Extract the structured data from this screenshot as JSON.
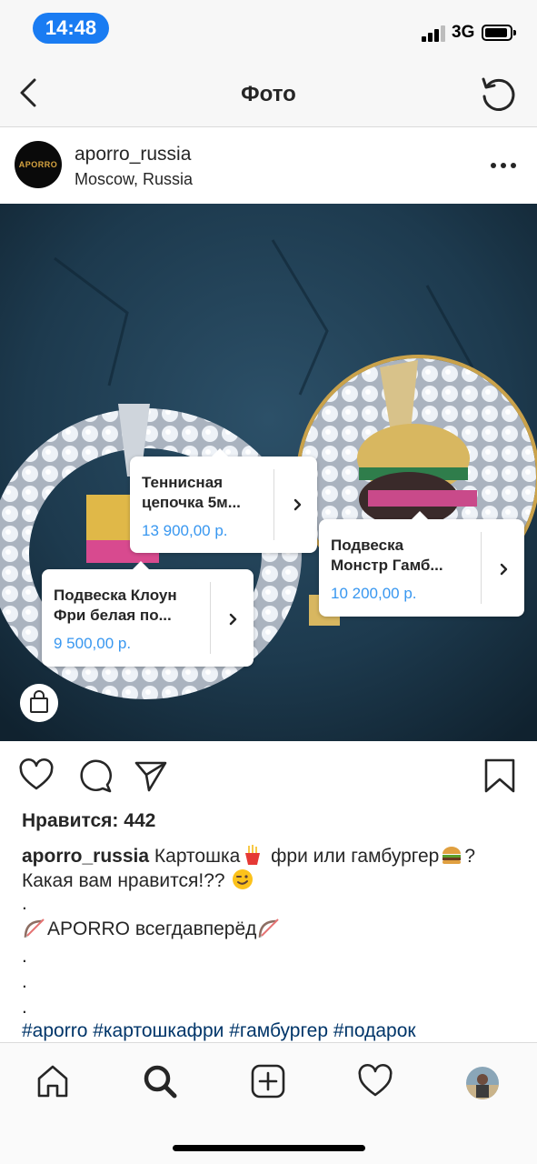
{
  "status_bar": {
    "time": "14:48",
    "network": "3G"
  },
  "nav": {
    "title": "Фото",
    "back_icon": "chevron-left-icon",
    "refresh_icon": "refresh-icon"
  },
  "post": {
    "username": "aporro_russia",
    "location": "Moscow, Russia",
    "avatar_text": "APORRO",
    "more_icon": "more-horizontal-icon"
  },
  "product_tags": [
    {
      "name_line1": "Теннисная",
      "name_line2": "цепочка 5м...",
      "price": "13 900,00 р."
    },
    {
      "name_line1": "Подвеска Клоун",
      "name_line2": "Фри белая по...",
      "price": "9 500,00 р."
    },
    {
      "name_line1": "Подвеска",
      "name_line2": "Монстр Гамб...",
      "price": "10 200,00 р."
    }
  ],
  "actions": {
    "like_icon": "heart-icon",
    "comment_icon": "comment-icon",
    "share_icon": "send-icon",
    "save_icon": "bookmark-icon"
  },
  "likes": "Нравится: 442",
  "caption": {
    "user": "aporro_russia",
    "text_a": "Картошка",
    "text_b": "фри или гамбургер",
    "text_c": "?",
    "line2": "Какая вам нравится!??",
    "dot1": ".",
    "brand": "APORRO всегдавперёд",
    "dot2": ".",
    "dot3": ".",
    "dot4": ".",
    "hashtags": "#aporro #картошкафри #гамбургер #подарок"
  },
  "tabbar": [
    "home-icon",
    "search-icon",
    "add-icon",
    "activity-heart-icon",
    "profile-avatar"
  ],
  "colors": {
    "accent": "#3897f0",
    "time_pill": "#1a7cf2",
    "hashtag": "#003569",
    "photo_bg": "#1d3a4e"
  }
}
